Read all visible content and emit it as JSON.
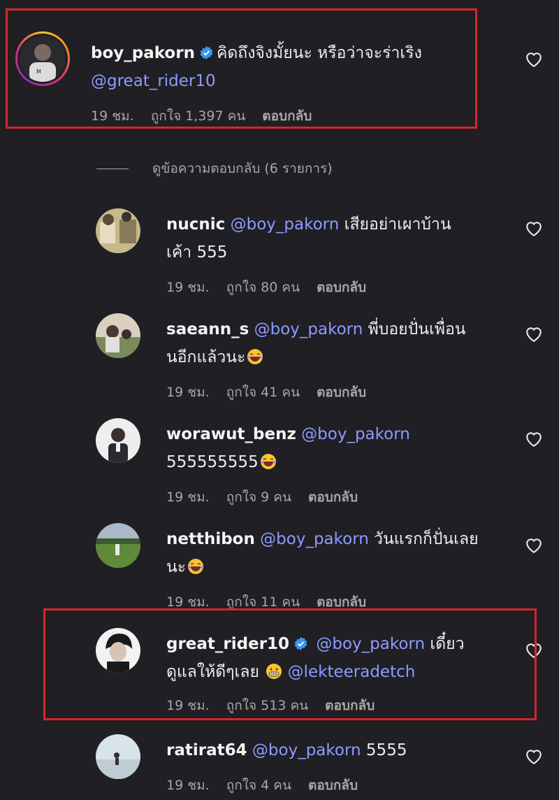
{
  "main_comment": {
    "username": "boy_pakorn",
    "text": "คิดถึงจิงมั้ยนะ หรือว่าจะร่าเริง",
    "mention": "@great_rider10",
    "time": "19 ชม.",
    "likes": "ถูกใจ 1,397 คน",
    "reply": "ตอบกลับ"
  },
  "view_replies": "ดูข้อความตอบกลับ (6 รายการ)",
  "replies": [
    {
      "username": "nucnic",
      "mention": "@boy_pakorn",
      "text1": "เสียอย่าเผาบ้าน",
      "text2": "เค้า 555",
      "time": "19 ชม.",
      "likes": "ถูกใจ 80 คน",
      "reply": "ตอบกลับ"
    },
    {
      "username": "saeann_s",
      "mention": "@boy_pakorn",
      "text1": "พี่บอยปั่นเพื่อน",
      "text2": "นอีกแล้วนะ",
      "time": "19 ชม.",
      "likes": "ถูกใจ 41 คน",
      "reply": "ตอบกลับ"
    },
    {
      "username": "worawut_benz",
      "mention": "@boy_pakorn",
      "text1": "",
      "text2": "555555555",
      "time": "19 ชม.",
      "likes": "ถูกใจ 9 คน",
      "reply": "ตอบกลับ"
    },
    {
      "username": "netthibon",
      "mention": "@boy_pakorn",
      "text1": "วันแรกก็ปั่นเลย",
      "text2": "นะ",
      "time": "19 ชม.",
      "likes": "ถูกใจ 11 คน",
      "reply": "ตอบกลับ"
    },
    {
      "username": "great_rider10",
      "mention": "@boy_pakorn",
      "text1": "เดี๋ยว",
      "text2": "ดูแลให้ดีๆเลย",
      "mention2": "@lekteeradetch",
      "time": "19 ชม.",
      "likes": "ถูกใจ 513 คน",
      "reply": "ตอบกลับ"
    },
    {
      "username": "ratirat64",
      "mention": "@boy_pakorn",
      "text1": "5555",
      "text2": "",
      "time": "19 ชม.",
      "likes": "ถูกใจ 4 คน",
      "reply": "ตอบกลับ"
    }
  ],
  "colors": {
    "background": "#1f1f24",
    "mention": "#8e9bff",
    "highlight": "#d6262b",
    "verified": "#3897f0"
  }
}
